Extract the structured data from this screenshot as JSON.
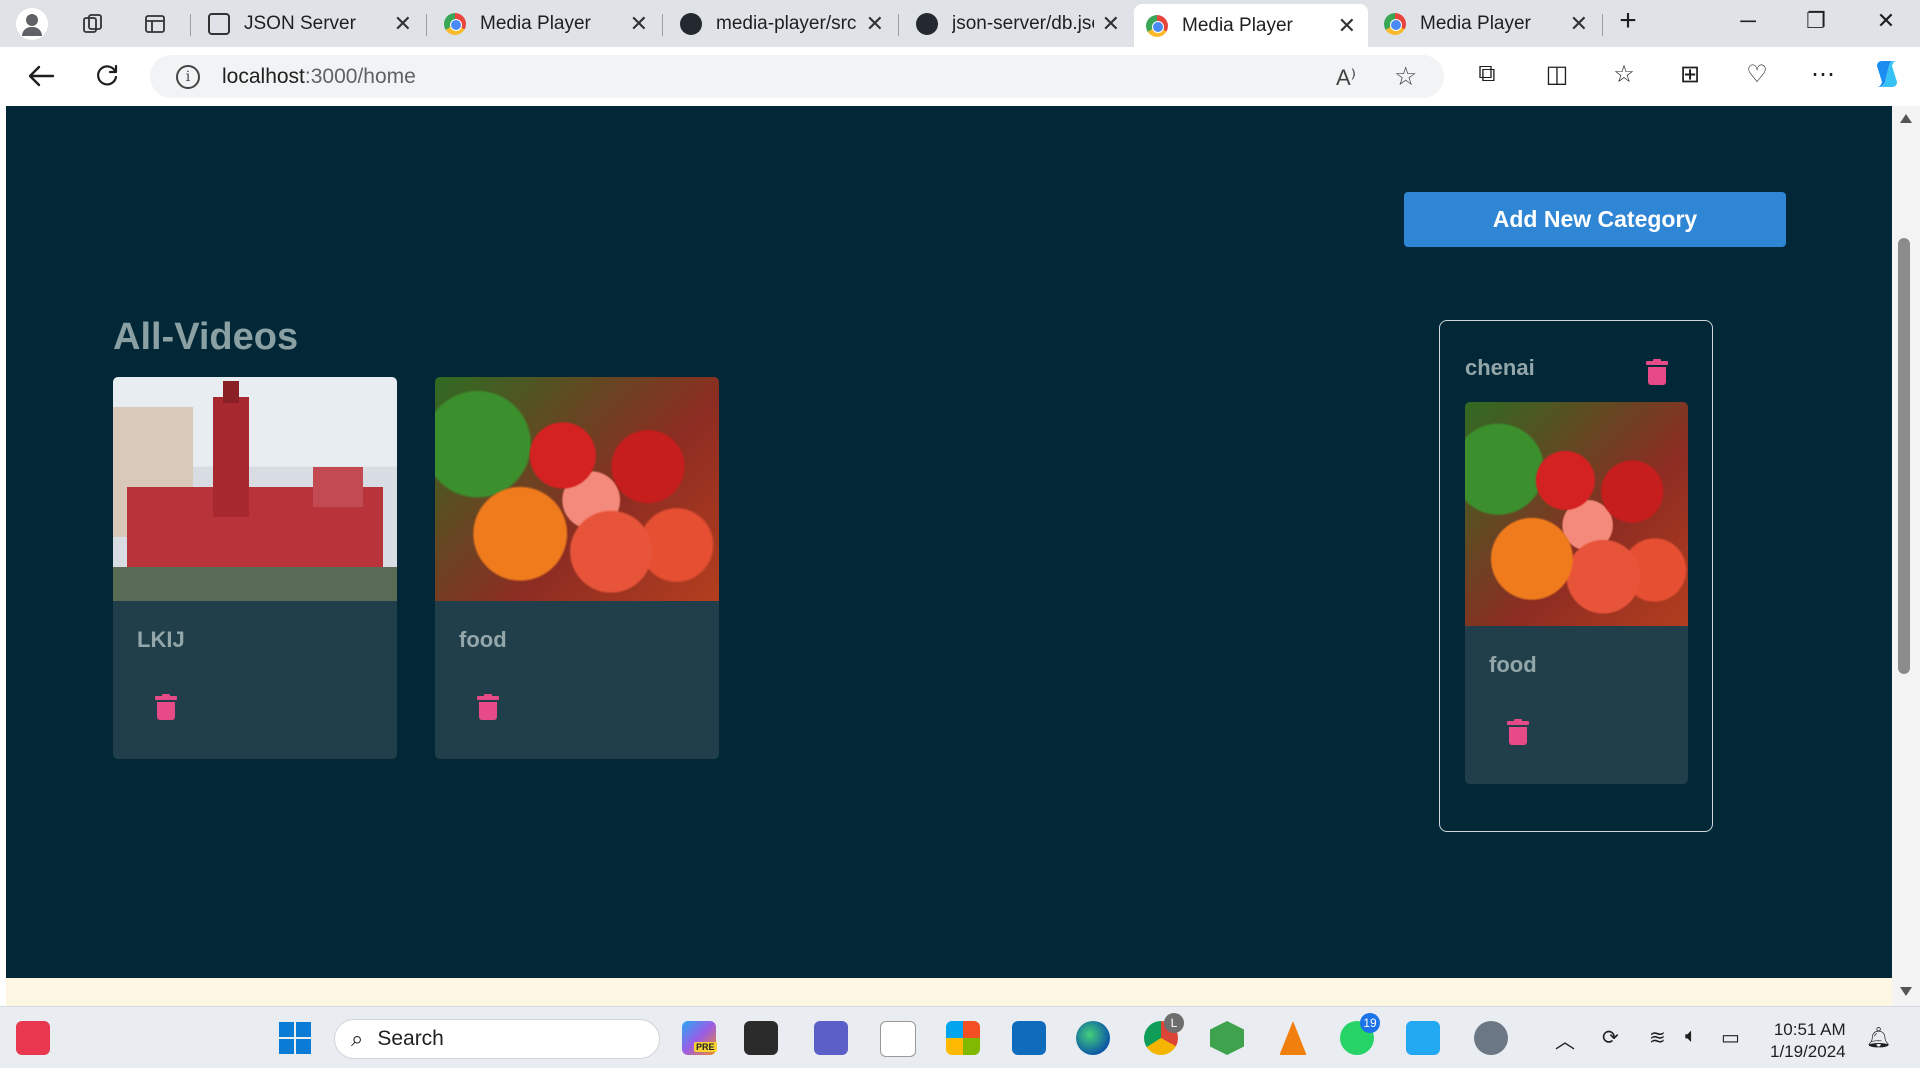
{
  "browser": {
    "tabs": [
      {
        "title": "JSON Server",
        "icon": "json-server-favicon-icon"
      },
      {
        "title": "Media Player",
        "icon": "media-player-favicon-icon"
      },
      {
        "title": "media-player/src",
        "icon": "github-icon"
      },
      {
        "title": "json-server/db.jsc",
        "icon": "github-icon"
      },
      {
        "title": "Media Player",
        "icon": "media-player-favicon-icon",
        "active": true
      },
      {
        "title": "Media Player",
        "icon": "media-player-favicon-icon"
      }
    ],
    "url_host": "localhost",
    "url_rest": ":3000/home"
  },
  "page": {
    "add_button_label": "Add New Category",
    "section_title": "All-Videos",
    "videos": [
      {
        "title": "LKIJ",
        "thumbnail": "building"
      },
      {
        "title": "food",
        "thumbnail": "vegetables"
      }
    ],
    "category": {
      "name": "chenai",
      "videos": [
        {
          "title": "food",
          "thumbnail": "vegetables"
        }
      ]
    }
  },
  "taskbar": {
    "search_label": "Search",
    "time": "10:51 AM",
    "date": "1/19/2024",
    "whatsapp_badge": "19",
    "chrome_badge": "L",
    "copilot_badge": "PRE"
  },
  "colors": {
    "page_bg": "#022838",
    "card_bg": "#213f4a",
    "button_bg": "#2e86d4",
    "trash": "#e64a87",
    "title_text": "#8aa0a3"
  }
}
